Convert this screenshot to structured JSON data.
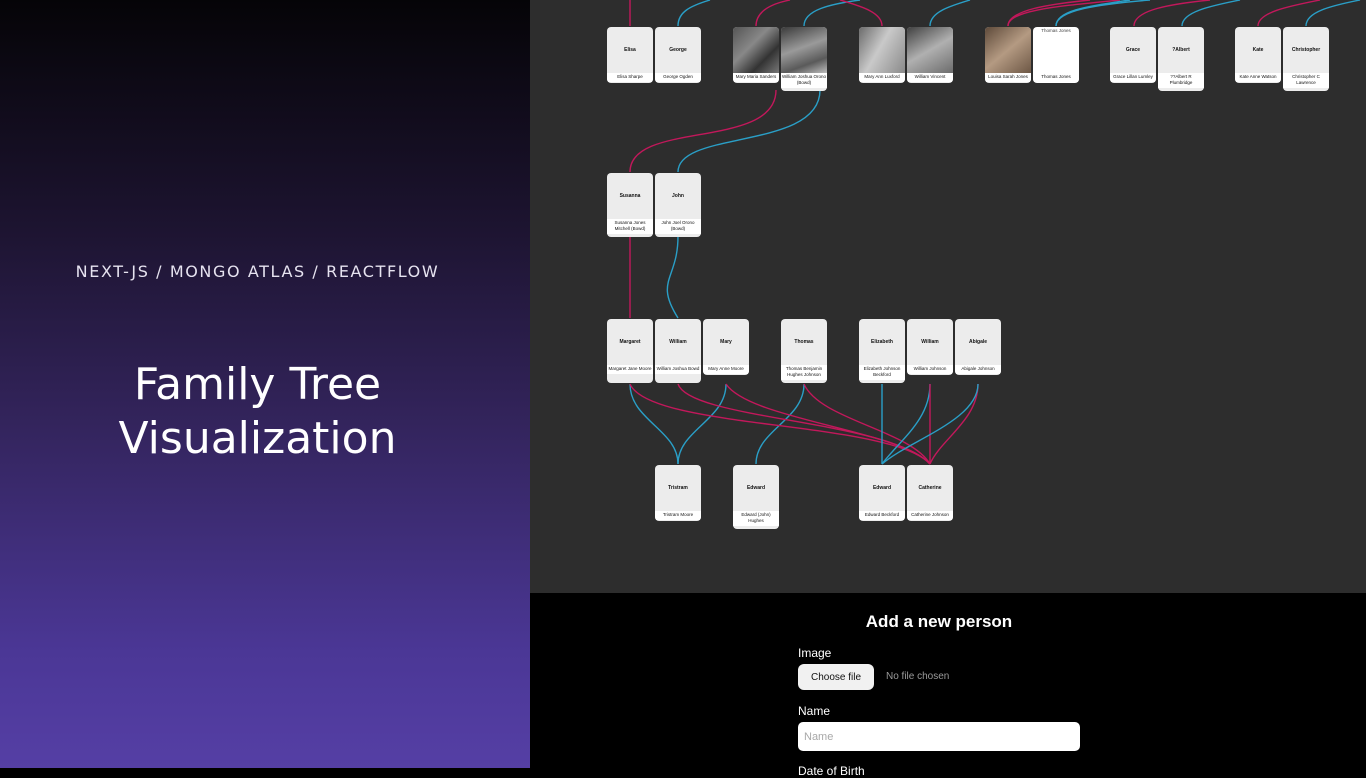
{
  "slide": {
    "stack": "NEXT-JS / MONGO ATLAS / REACTFLOW",
    "title_line1": "Family Tree",
    "title_line2": "Visualization"
  },
  "tree": {
    "edge_colors": {
      "mother": "#c2185b",
      "father": "#2a9fc7"
    },
    "nodes": {
      "elisa": {
        "first": "Elisa",
        "full": "Elisa Sharpe"
      },
      "george": {
        "first": "George",
        "full": "George Ogden"
      },
      "mary_maria": {
        "first": "",
        "full": "Mary Maria Sanders"
      },
      "william_orono": {
        "first": "",
        "full": "William Joshua Orono (Bowd)"
      },
      "mary_ann": {
        "first": "",
        "full": "Mary Ann Luxford"
      },
      "william_vincent": {
        "first": "",
        "full": "William Vincent"
      },
      "louisa": {
        "first": "",
        "full": "Louisa Sarah Jones"
      },
      "thomas_jones": {
        "first": "",
        "top": "Thomas Jones",
        "full": "Thomas Jones"
      },
      "grace": {
        "first": "Grace",
        "full": "Grace Lillan Lumley"
      },
      "albert": {
        "first": "?Albert",
        "full": "??Albert R Plumbridge"
      },
      "kate": {
        "first": "Kate",
        "full": "Kate Anne Watson"
      },
      "christopher": {
        "first": "Christopher",
        "full": "Christopher C Lawrence"
      },
      "susanna": {
        "first": "Susanna",
        "full": "Susanna Jones Mitchell (Bowd)"
      },
      "john": {
        "first": "John",
        "full": "John Joel Orono (Bowd)"
      },
      "margaret": {
        "first": "Margaret",
        "full": "Margaret Jane Moore"
      },
      "william_bowd": {
        "first": "William",
        "full": "William Joshua Bowd"
      },
      "mary_moore": {
        "first": "Mary",
        "full": "Mary Anne Moore"
      },
      "thomas_hughes": {
        "first": "Thomas",
        "full": "Thomas Benjamin Hughes Johnson"
      },
      "elizabeth": {
        "first": "Elizabeth",
        "full": "Elizabeth Johnson Beckford"
      },
      "william_johnson": {
        "first": "William",
        "full": "William Johnson"
      },
      "abigale": {
        "first": "Abigale",
        "full": "Abigale Johnson"
      },
      "tristram": {
        "first": "Tristram",
        "full": "Tristram Moore"
      },
      "edward_hughes": {
        "first": "Edward",
        "full": "Edward (John) Hughes"
      },
      "edward_beckford": {
        "first": "Edward",
        "full": "Edward Beckford"
      },
      "catherine": {
        "first": "Catherine",
        "full": "Catherine Johnson"
      }
    }
  },
  "form": {
    "heading": "Add a new person",
    "image_label": "Image",
    "choose_file": "Choose file",
    "no_file": "No file chosen",
    "name_label": "Name",
    "name_placeholder": "Name",
    "dob_label": "Date of Birth"
  }
}
